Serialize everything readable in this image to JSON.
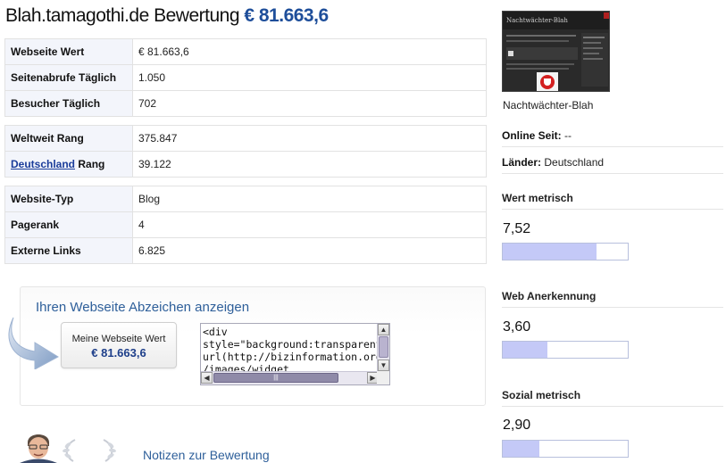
{
  "header": {
    "site": "Blah.tamagothi.de Bewertung",
    "value": "€ 81.663,6"
  },
  "stats_groups": [
    [
      {
        "label": "Webseite Wert",
        "value": "€ 81.663,6"
      },
      {
        "label": "Seitenabrufe Täglich",
        "value": "1.050"
      },
      {
        "label": "Besucher Täglich",
        "value": "702"
      }
    ],
    [
      {
        "label": "Weltweit Rang",
        "value": "375.847"
      },
      {
        "label_link": "Deutschland",
        "label_suffix": " Rang",
        "value": "39.122"
      }
    ],
    [
      {
        "label": "Website-Typ",
        "value": "Blog"
      },
      {
        "label": "Pagerank",
        "value": "4"
      },
      {
        "label": "Externe Links",
        "value": "6.825"
      }
    ]
  ],
  "badge": {
    "title": "Ihren Webseite Abzeichen anzeigen",
    "button_line1": "Meine Webseite Wert",
    "button_line2": "€ 81.663,6",
    "code": "<div\nstyle=\"background:transparent\nurl(http://bizinformation.org\n/images/widget"
  },
  "notes": {
    "label": "Notizen zur Bewertung"
  },
  "sidebar": {
    "thumbnail_title": "Nachtwächter-Blah",
    "site_name": "Nachtwächter-Blah",
    "online_label": "Online Seit:",
    "online_value": " --",
    "countries_label": "Länder:",
    "countries_value": " Deutschland"
  },
  "metrics": [
    {
      "label": "Wert metrisch",
      "value": "7,52",
      "fill_fraction": 0.752
    },
    {
      "label": "Web Anerkennung",
      "value": "3,60",
      "fill_fraction": 0.36
    },
    {
      "label": "Sozial metrisch",
      "value": "2,90",
      "fill_fraction": 0.29
    }
  ],
  "colors": {
    "accent": "#1e4e9a",
    "link": "#1a3c9a",
    "bar_fill": "#c4c9f7",
    "label_bg": "#f3f5fb"
  }
}
